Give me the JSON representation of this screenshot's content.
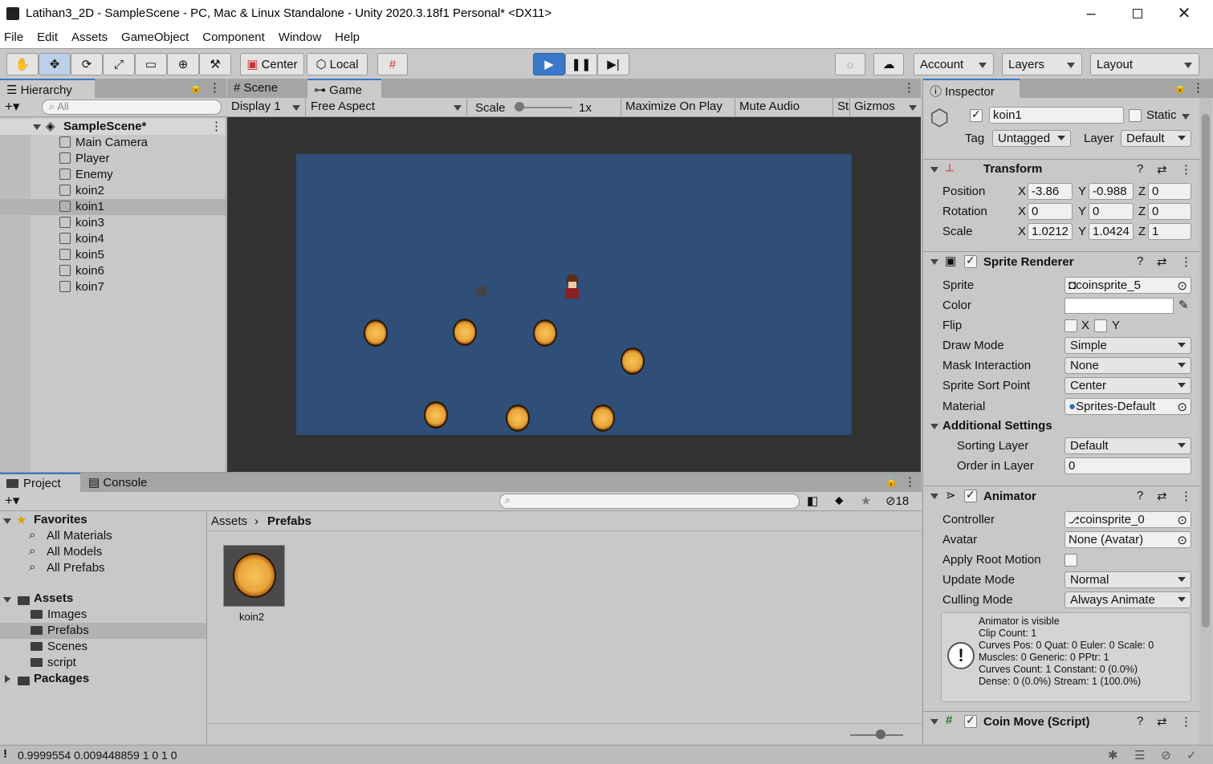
{
  "window": {
    "title": "Latihan3_2D - SampleScene - PC, Mac & Linux Standalone - Unity 2020.3.18f1 Personal* <DX11>"
  },
  "menu": [
    "File",
    "Edit",
    "Assets",
    "GameObject",
    "Component",
    "Window",
    "Help"
  ],
  "toolbar": {
    "center": "Center",
    "local": "Local",
    "account": "Account",
    "layers": "Layers",
    "layout": "Layout"
  },
  "hierarchy": {
    "tab": "Hierarchy",
    "search_placeholder": "All",
    "scene": "SampleScene*",
    "items": [
      "Main Camera",
      "Player",
      "Enemy",
      "koin2",
      "koin1",
      "koin3",
      "koin4",
      "koin5",
      "koin6",
      "koin7"
    ],
    "selected": "koin1"
  },
  "game": {
    "tabs": [
      "Scene",
      "Game"
    ],
    "display": "Display 1",
    "aspect": "Free Aspect",
    "scale_label": "Scale",
    "scale_value": "1x",
    "buttons": [
      "Maximize On Play",
      "Mute Audio",
      "Stats",
      "Gizmos"
    ],
    "bg_color": "#2f4e78"
  },
  "inspector": {
    "tab": "Inspector",
    "object_name": "koin1",
    "static_label": "Static",
    "tag_label": "Tag",
    "tag_value": "Untagged",
    "layer_label": "Layer",
    "layer_value": "Default",
    "transform": {
      "title": "Transform",
      "position_label": "Position",
      "position": [
        "-3.86",
        "-0.988",
        "0"
      ],
      "rotation_label": "Rotation",
      "rotation": [
        "0",
        "0",
        "0"
      ],
      "scale_label": "Scale",
      "scale": [
        "1.0212",
        "1.0424",
        "1"
      ],
      "axes": [
        "X",
        "Y",
        "Z"
      ]
    },
    "sprite_renderer": {
      "title": "Sprite Renderer",
      "sprite_label": "Sprite",
      "sprite": "coinsprite_5",
      "color_label": "Color",
      "flip_label": "Flip",
      "flip_x": "X",
      "flip_y": "Y",
      "draw_mode_label": "Draw Mode",
      "draw_mode": "Simple",
      "mask_label": "Mask Interaction",
      "mask": "None",
      "sort_point_label": "Sprite Sort Point",
      "sort_point": "Center",
      "material_label": "Material",
      "material": "Sprites-Default",
      "additional": "Additional Settings",
      "sorting_layer_label": "Sorting Layer",
      "sorting_layer": "Default",
      "order_label": "Order in Layer",
      "order": "0"
    },
    "animator": {
      "title": "Animator",
      "controller_label": "Controller",
      "controller": "coinsprite_0",
      "avatar_label": "Avatar",
      "avatar": "None (Avatar)",
      "root_motion_label": "Apply Root Motion",
      "update_label": "Update Mode",
      "update": "Normal",
      "culling_label": "Culling Mode",
      "culling": "Always Animate",
      "info": [
        "Animator is visible",
        "Clip Count: 1",
        "Curves Pos: 0 Quat: 0 Euler: 0 Scale: 0",
        "Muscles: 0 Generic: 0 PPtr: 1",
        "Curves Count: 1 Constant: 0 (0.0%)",
        "Dense: 0 (0.0%) Stream: 1 (100.0%)"
      ]
    },
    "coin_move": {
      "title": "Coin Move (Script)"
    }
  },
  "project": {
    "tabs": [
      "Project",
      "Console"
    ],
    "hidden_count": "18",
    "favorites": "Favorites",
    "favorite_items": [
      "All Materials",
      "All Models",
      "All Prefabs"
    ],
    "assets": "Assets",
    "asset_folders": [
      "Images",
      "Prefabs",
      "Scenes",
      "script"
    ],
    "packages": "Packages",
    "breadcrumb": [
      "Assets",
      "Prefabs"
    ],
    "files": [
      {
        "name": "koin2"
      }
    ]
  },
  "statusbar": {
    "text": "0.9999554 0.009448859 1 0 1 0"
  }
}
